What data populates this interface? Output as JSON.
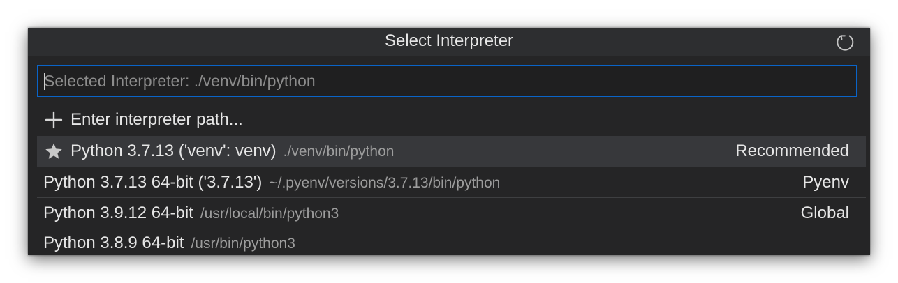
{
  "picker": {
    "title": "Select Interpreter",
    "refresh_icon": "refresh-icon",
    "input": {
      "value": "",
      "placeholder": "Selected Interpreter: ./venv/bin/python"
    },
    "enter_path": {
      "icon": "plus-icon",
      "label": "Enter interpreter path..."
    },
    "items": [
      {
        "icon": "star-icon",
        "label": "Python 3.7.13 ('venv': venv)",
        "description": "./venv/bin/python",
        "tag": "Recommended"
      },
      {
        "label": "Python 3.7.13 64-bit ('3.7.13')",
        "description": "~/.pyenv/versions/3.7.13/bin/python",
        "tag": "Pyenv"
      },
      {
        "label": "Python 3.9.12 64-bit",
        "description": "/usr/local/bin/python3",
        "tag": "Global"
      },
      {
        "label": "Python 3.8.9 64-bit",
        "description": "/usr/bin/python3",
        "tag": ""
      }
    ]
  },
  "colors": {
    "background": "#252526",
    "titlebar": "#2d2e30",
    "input_border": "#0a64c8",
    "active_row": "#37383b",
    "text": "#e6e6e6",
    "muted_text": "#9d9d9d"
  }
}
